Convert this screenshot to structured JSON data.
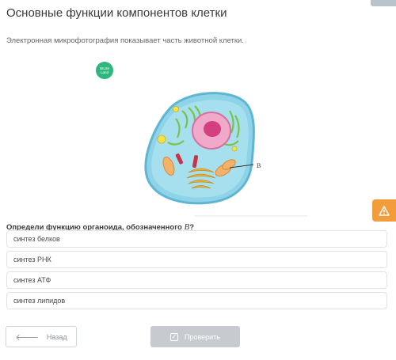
{
  "page": {
    "title": "Основные функции компонентов клетки",
    "subtitle": "Электронная микрофотография показывает часть животной клетки."
  },
  "image": {
    "logo_text_1": "BILIM",
    "logo_text_2": "Land",
    "label_b": "B"
  },
  "question": {
    "text": "Определи функцию органоида, обозначенного ",
    "emphasis": "B",
    "suffix": "?"
  },
  "options": [
    {
      "label": "синтез белков"
    },
    {
      "label": "синтез РНК"
    },
    {
      "label": "синтез АТФ"
    },
    {
      "label": "синтез липидов"
    }
  ],
  "buttons": {
    "back_label": "Назад",
    "check_label": "Проверить"
  },
  "colors": {
    "accent_orange": "#f39c3c",
    "logo_green": "#2eb67d",
    "disabled_gray": "#c7cbd0"
  },
  "icons": {
    "back": "arrow-left-icon",
    "check": "checkbox-icon",
    "warning": "warning-icon"
  }
}
